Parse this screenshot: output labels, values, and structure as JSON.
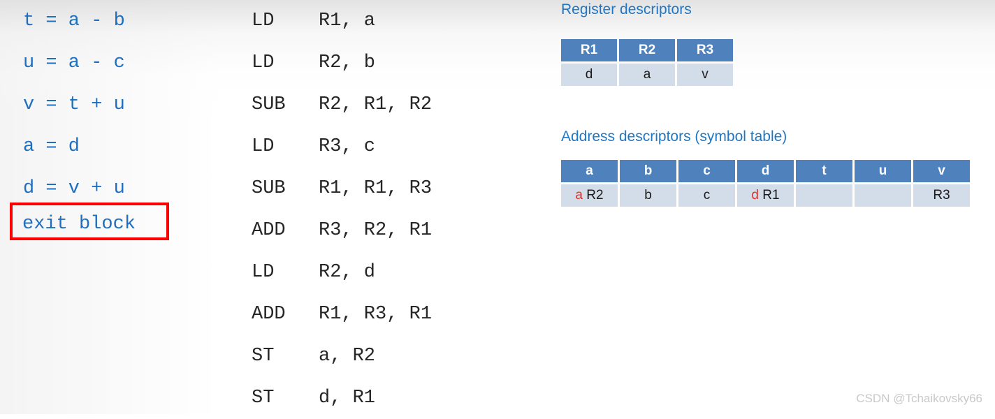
{
  "colors": {
    "source_blue": "#1F6FC0",
    "asm_black": "#262626",
    "heading_blue": "#1F77C4",
    "table_header_blue": "#4F81BD",
    "table_cell_blue": "#D3DCE9",
    "highlight_red": "#EE2B20",
    "box_border_red": "#FF0000",
    "watermark_gray": "#C9C9C9"
  },
  "source_code": {
    "lines": [
      "t = a - b",
      "u = a - c",
      "v = t + u",
      "a = d",
      "d = v + u"
    ],
    "exit_label": "exit block"
  },
  "target_code": {
    "lines": [
      {
        "op": "LD",
        "args": "R1, a"
      },
      {
        "op": "LD",
        "args": "R2, b"
      },
      {
        "op": "SUB",
        "args": "R2, R1, R2"
      },
      {
        "op": "LD",
        "args": "R3, c"
      },
      {
        "op": "SUB",
        "args": "R1, R1, R3"
      },
      {
        "op": "ADD",
        "args": "R3, R2, R1"
      },
      {
        "op": "LD",
        "args": "R2, d"
      },
      {
        "op": "ADD",
        "args": "R1, R3, R1"
      },
      {
        "op": "ST",
        "args": "a, R2"
      },
      {
        "op": "ST",
        "args": "d, R1"
      }
    ]
  },
  "register_descriptors": {
    "heading": "Register descriptors",
    "headers": [
      "R1",
      "R2",
      "R3"
    ],
    "values": [
      "d",
      "a",
      "v"
    ]
  },
  "address_descriptors": {
    "heading": "Address descriptors (symbol table)",
    "headers": [
      "a",
      "b",
      "c",
      "d",
      "t",
      "u",
      "v"
    ],
    "cells": [
      {
        "red": "a",
        "plain": " R2"
      },
      {
        "red": "",
        "plain": "b"
      },
      {
        "red": "",
        "plain": "c"
      },
      {
        "red": "d",
        "plain": " R1"
      },
      {
        "red": "",
        "plain": ""
      },
      {
        "red": "",
        "plain": ""
      },
      {
        "red": "",
        "plain": "R3"
      }
    ]
  },
  "watermark": {
    "text": "CSDN @Tchaikovsky66"
  }
}
